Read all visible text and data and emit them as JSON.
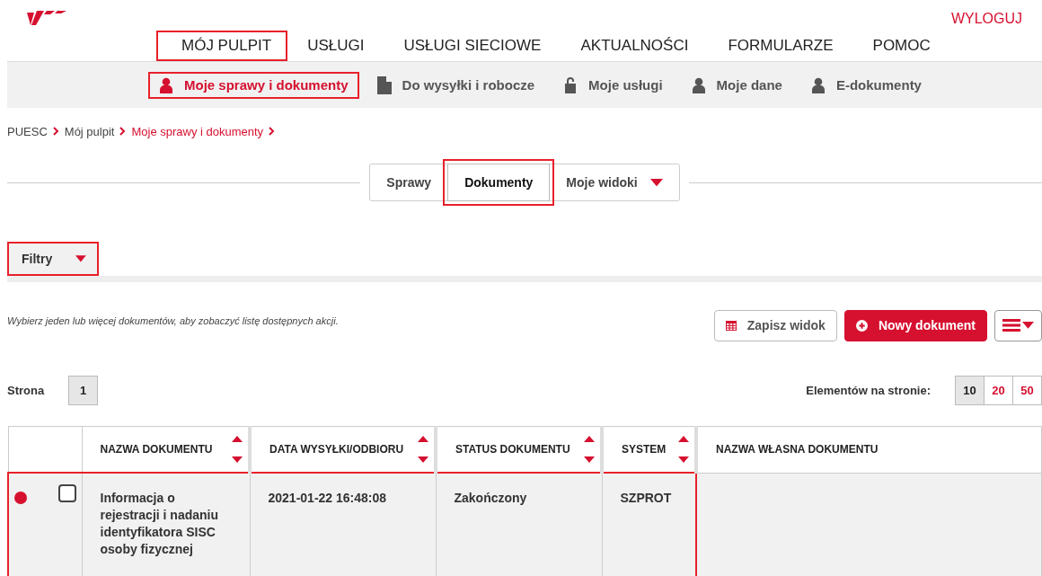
{
  "header": {
    "logout": "WYLOGUJ"
  },
  "main_nav": [
    {
      "label": "MÓJ PULPIT",
      "highlighted": true
    },
    {
      "label": "USŁUGI",
      "highlighted": false
    },
    {
      "label": "USŁUGI SIECIOWE",
      "highlighted": false
    },
    {
      "label": "AKTUALNOŚCI",
      "highlighted": false
    },
    {
      "label": "FORMULARZE",
      "highlighted": false
    },
    {
      "label": "POMOC",
      "highlighted": false
    }
  ],
  "sub_nav": [
    {
      "label": "Moje sprawy i dokumenty",
      "kind": "user",
      "selected": true,
      "highlighted": true
    },
    {
      "label": "Do wysyłki i robocze",
      "kind": "document",
      "selected": false,
      "highlighted": false
    },
    {
      "label": "Moje usługi",
      "kind": "lock",
      "selected": false,
      "highlighted": false
    },
    {
      "label": "Moje dane",
      "kind": "user",
      "selected": false,
      "highlighted": false
    },
    {
      "label": "E-dokumenty",
      "kind": "user",
      "selected": false,
      "highlighted": false
    }
  ],
  "breadcrumb": [
    {
      "label": "PUESC",
      "current": false
    },
    {
      "label": "Mój pulpit",
      "current": false
    },
    {
      "label": "Moje sprawy i dokumenty",
      "current": true
    }
  ],
  "view_tabs": [
    {
      "label": "Sprawy",
      "selected": false,
      "highlighted": false,
      "dropdown": false
    },
    {
      "label": "Dokumenty",
      "selected": true,
      "highlighted": true,
      "dropdown": false
    },
    {
      "label": "Moje widoki",
      "selected": false,
      "highlighted": false,
      "dropdown": true
    }
  ],
  "filters": {
    "label": "Filtry",
    "highlighted": true
  },
  "hint": "Wybierz jeden lub więcej dokumentów, aby zobaczyć listę dostępnych akcji.",
  "actions": [
    {
      "kind": "save",
      "label": "Zapisz widok"
    },
    {
      "kind": "new",
      "label": "Nowy dokument"
    },
    {
      "kind": "menu"
    }
  ],
  "pager": {
    "label": "Strona",
    "pages": [
      {
        "label": "1",
        "selected": true
      }
    ],
    "per_page_label": "Elementów na stronie:",
    "per_page": [
      {
        "label": "10",
        "selected": true
      },
      {
        "label": "20",
        "selected": false
      },
      {
        "label": "50",
        "selected": false
      }
    ]
  },
  "table": {
    "columns": [
      {
        "label": "NAZWA DOKUMENTU",
        "sortable": true
      },
      {
        "label": "DATA WYSYŁKI/ODBIORU",
        "sortable": true
      },
      {
        "label": "STATUS DOKUMENTU",
        "sortable": true
      },
      {
        "label": "SYSTEM",
        "sortable": true
      },
      {
        "label": "NAZWA WŁASNA DOKUMENTU",
        "sortable": false
      }
    ],
    "rows": [
      {
        "color": "#d6102f",
        "checked": false,
        "highlighted": true,
        "cells": [
          "Informacja o rejestracji i nadaniu identyfikatora SISC osoby fizycznej",
          "2021-01-22 16:48:08",
          "Zakończony",
          "SZPROT"
        ]
      }
    ]
  }
}
